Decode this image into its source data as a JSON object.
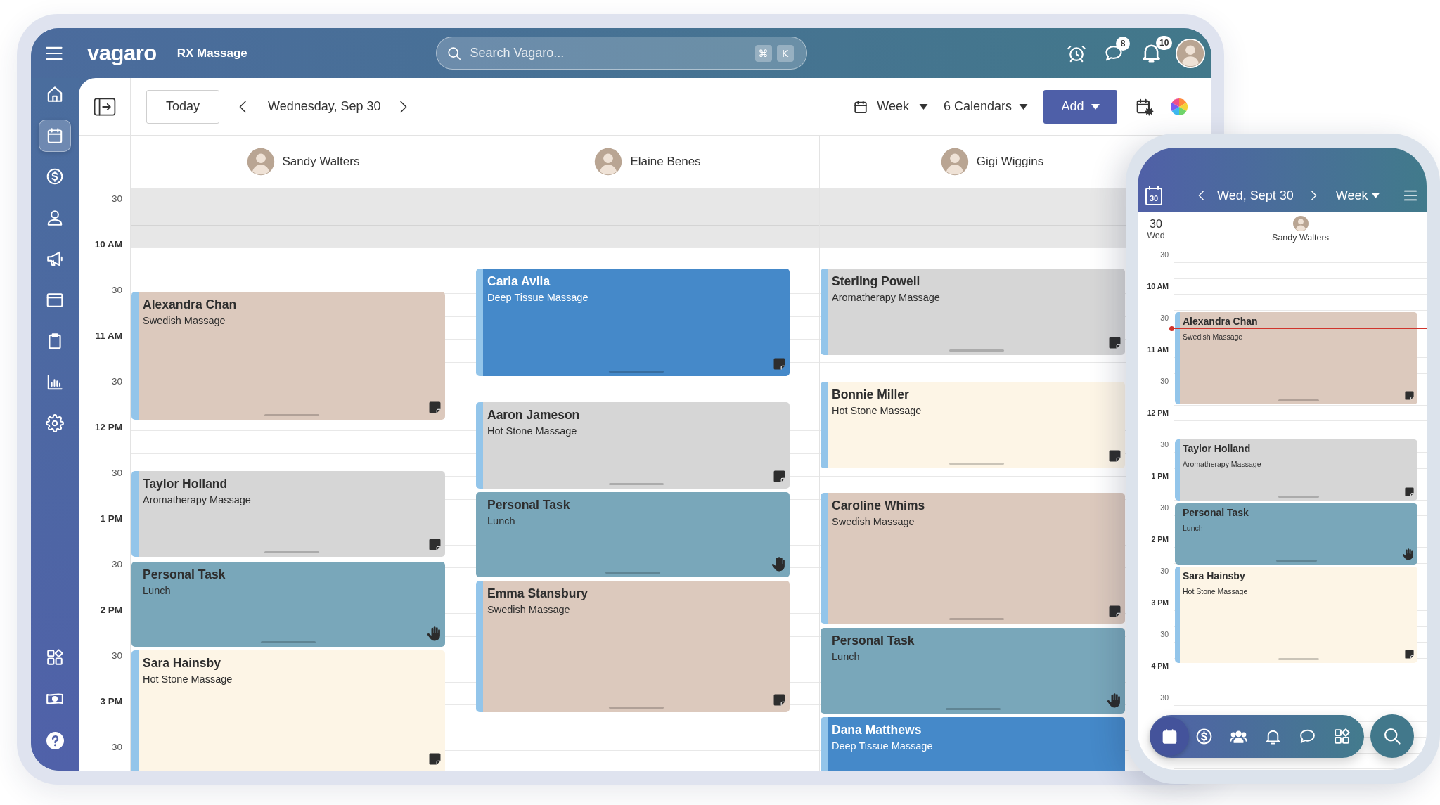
{
  "top_bar": {
    "brand": "vagaro",
    "business": "RX Massage",
    "search": {
      "placeholder": "Search Vagaro...",
      "shortcut_keys": [
        "⌘",
        "K"
      ]
    },
    "message_count": "8",
    "notification_count": "10"
  },
  "sidebar": {
    "top_items": [
      {
        "selected": false
      },
      {
        "selected": true
      },
      {
        "selected": false
      },
      {
        "selected": false
      },
      {
        "selected": false
      },
      {
        "selected": false
      },
      {
        "selected": false
      },
      {
        "selected": false
      },
      {
        "selected": false
      }
    ],
    "bottom_items": [
      {
        "selected": false
      },
      {
        "selected": false
      },
      {
        "selected": false
      }
    ]
  },
  "toolbar": {
    "today": "Today",
    "date": "Wednesday, Sep 30",
    "view": "Week",
    "calendars": "6 Calendars",
    "add": "Add"
  },
  "time_labels": [
    {
      "text": "30",
      "kind": "half"
    },
    {
      "text": "10 AM",
      "kind": "hour"
    },
    {
      "text": "30",
      "kind": "half"
    },
    {
      "text": "11 AM",
      "kind": "hour"
    },
    {
      "text": "30",
      "kind": "half"
    },
    {
      "text": "12 PM",
      "kind": "hour"
    },
    {
      "text": "30",
      "kind": "half"
    },
    {
      "text": "1 PM",
      "kind": "hour"
    },
    {
      "text": "30",
      "kind": "half"
    },
    {
      "text": "2 PM",
      "kind": "hour"
    },
    {
      "text": "30",
      "kind": "half"
    },
    {
      "text": "3 PM",
      "kind": "hour"
    },
    {
      "text": "30",
      "kind": "half"
    }
  ],
  "columns": [
    {
      "staff": "Sandy Walters",
      "appointments": [
        {
          "title": "Alexandra Chan",
          "subtitle": "Swedish Massage",
          "kind": "appointment",
          "color": "#dcc9bd"
        },
        {
          "title": "Taylor Holland",
          "subtitle": "Aromatherapy Massage",
          "kind": "appointment",
          "color": "#d6d6d6"
        },
        {
          "title": "Personal Task",
          "subtitle": "Lunch",
          "kind": "task",
          "color": "#79a7ba"
        },
        {
          "title": "Sara Hainsby",
          "subtitle": "Hot Stone Massage",
          "kind": "appointment",
          "color": "#fdf5e6"
        }
      ]
    },
    {
      "staff": "Elaine Benes",
      "appointments": [
        {
          "title": "Carla Avila",
          "subtitle": "Deep Tissue Massage",
          "kind": "appointment",
          "color": "#4589c9"
        },
        {
          "title": "Aaron Jameson",
          "subtitle": "Hot Stone Massage",
          "kind": "appointment",
          "color": "#d6d6d6"
        },
        {
          "title": "Personal Task",
          "subtitle": "Lunch",
          "kind": "task",
          "color": "#79a7ba"
        },
        {
          "title": "Emma Stansbury",
          "subtitle": "Swedish Massage",
          "kind": "appointment",
          "color": "#dcc9bd"
        }
      ]
    },
    {
      "staff": "Gigi Wiggins",
      "appointments": [
        {
          "title": "Sterling Powell",
          "subtitle": "Aromatherapy Massage",
          "kind": "appointment",
          "color": "#d6d6d6"
        },
        {
          "title": "Bonnie Miller",
          "subtitle": "Hot Stone Massage",
          "kind": "appointment",
          "color": "#fdf5e6"
        },
        {
          "title": "Caroline Whims",
          "subtitle": "Swedish Massage",
          "kind": "appointment",
          "color": "#dcc9bd"
        },
        {
          "title": "Personal Task",
          "subtitle": "Lunch",
          "kind": "task",
          "color": "#79a7ba"
        },
        {
          "title": "Dana Matthews",
          "subtitle": "Deep Tissue Massage",
          "kind": "appointment",
          "color": "#4589c9"
        }
      ]
    }
  ],
  "phone": {
    "calendar_day": "30",
    "date": "Wed, Sept 30",
    "view": "Week",
    "day_number": "30",
    "day_name": "Wed",
    "staff": "Sandy Walters",
    "time_labels": [
      {
        "text": "30",
        "kind": "half"
      },
      {
        "text": "10 AM",
        "kind": "hour"
      },
      {
        "text": "30",
        "kind": "half"
      },
      {
        "text": "11 AM",
        "kind": "hour"
      },
      {
        "text": "30",
        "kind": "half"
      },
      {
        "text": "12 PM",
        "kind": "hour"
      },
      {
        "text": "30",
        "kind": "half"
      },
      {
        "text": "1 PM",
        "kind": "hour"
      },
      {
        "text": "30",
        "kind": "half"
      },
      {
        "text": "2 PM",
        "kind": "hour"
      },
      {
        "text": "30",
        "kind": "half"
      },
      {
        "text": "3 PM",
        "kind": "hour"
      },
      {
        "text": "30",
        "kind": "half"
      },
      {
        "text": "4 PM",
        "kind": "hour"
      },
      {
        "text": "30",
        "kind": "half"
      }
    ],
    "appointments": [
      {
        "title": "Alexandra Chan",
        "subtitle": "Swedish Massage",
        "kind": "appointment",
        "color": "#dcc9bd"
      },
      {
        "title": "Taylor Holland",
        "subtitle": "Aromatherapy Massage",
        "kind": "appointment",
        "color": "#d6d6d6"
      },
      {
        "title": "Personal Task",
        "subtitle": "Lunch",
        "kind": "task",
        "color": "#79a7ba"
      },
      {
        "title": "Sara Hainsby",
        "subtitle": "Hot Stone Massage",
        "kind": "appointment",
        "color": "#fdf5e6"
      }
    ],
    "nav_items": [
      {
        "selected": true
      },
      {
        "selected": false
      },
      {
        "selected": false
      },
      {
        "selected": false
      },
      {
        "selected": false
      },
      {
        "selected": false
      }
    ]
  }
}
